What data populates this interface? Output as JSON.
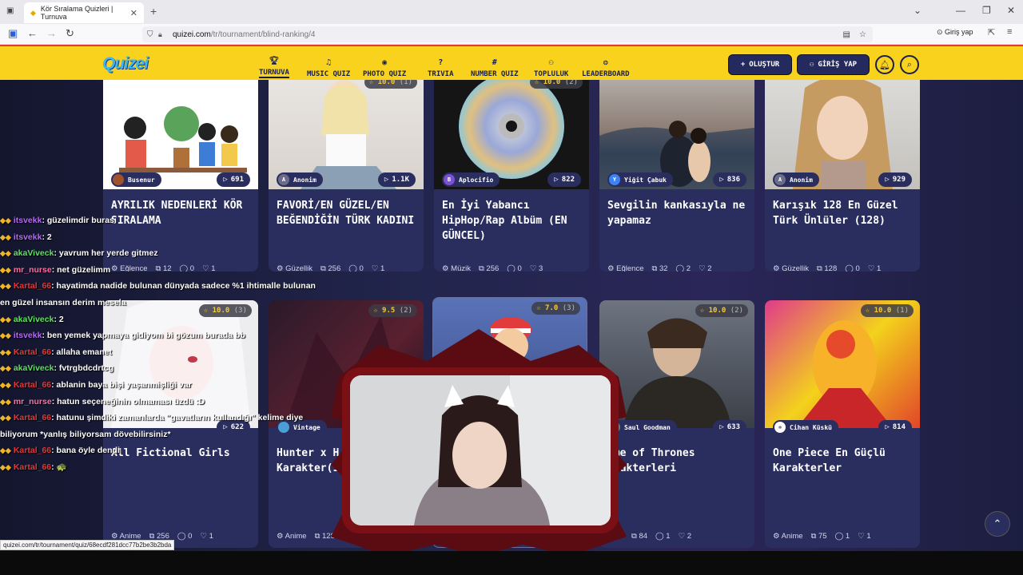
{
  "browser": {
    "tab_title": "Kör Sıralama Quizleri | Turnuva",
    "url_host": "quizei.com",
    "url_path": "/tr/tournament/blind-ranking/4",
    "login_label": "Giriş yap",
    "status_url": "quizei.com/tr/tournament/quiz/68ecdf281dcc77b2be3b2bda"
  },
  "site": {
    "logo": "Quizei",
    "nav": [
      {
        "label": "TURNUVA",
        "icon": "trophy-icon"
      },
      {
        "label": "MUSIC QUIZ",
        "icon": "music-icon"
      },
      {
        "label": "PHOTO QUIZ",
        "icon": "camera-icon"
      },
      {
        "label": "TRIVIA",
        "icon": "question-icon"
      },
      {
        "label": "NUMBER QUIZ",
        "icon": "hash-icon"
      },
      {
        "label": "TOPLULUK",
        "icon": "users-icon"
      },
      {
        "label": "LEADERBOARD",
        "icon": "medal-icon"
      }
    ],
    "create_label": "OLUŞTUR",
    "login_label": "GİRİŞ YAP"
  },
  "cards": [
    {
      "rating": "",
      "count": "",
      "author": "Busenur",
      "author_initial": "",
      "plays": "691",
      "title": "AYRILIK NEDENLERİ KÖR SIRALAMA",
      "category": "Eğlence",
      "items": "12",
      "comments": "0",
      "likes": "1"
    },
    {
      "rating": "10.0",
      "count": "(1)",
      "author": "Anonim",
      "author_initial": "A",
      "plays": "1.1K",
      "title": "FAVORİ/EN GÜZEL/EN BEĞENDİĞİN TÜRK KADINI",
      "category": "Güzellik",
      "items": "256",
      "comments": "0",
      "likes": "1"
    },
    {
      "rating": "10.0",
      "count": "(2)",
      "author": "Aplocifio",
      "author_initial": "B",
      "plays": "822",
      "title": "En İyi Yabancı HipHop/Rap Albüm (EN GÜNCEL)",
      "category": "Müzik",
      "items": "256",
      "comments": "0",
      "likes": "3"
    },
    {
      "rating": "",
      "count": "",
      "author": "Yiğit Çabuk",
      "author_initial": "Y",
      "plays": "836",
      "title": "Sevgilin kankasıyla ne yapamaz",
      "category": "Eğlence",
      "items": "32",
      "comments": "2",
      "likes": "2"
    },
    {
      "rating": "",
      "count": "",
      "author": "Anonim",
      "author_initial": "A",
      "plays": "929",
      "title": "Karışık 128 En Güzel Türk Ünlüler (128)",
      "category": "Güzellik",
      "items": "128",
      "comments": "0",
      "likes": "1"
    },
    {
      "rating": "10.0",
      "count": "(3)",
      "author": "",
      "author_initial": "",
      "plays": "622",
      "title": "All Fictional Girls",
      "category": "Anime",
      "items": "256",
      "comments": "0",
      "likes": "1"
    },
    {
      "rating": "9.5",
      "count": "(2)",
      "author": "Vintage",
      "author_initial": "",
      "plays": "",
      "title": "Hunter x H Anime/Mang Karakter(1",
      "category": "Anime",
      "items": "128",
      "comments": "0",
      "likes": ""
    },
    {
      "rating": "7.0",
      "count": "(3)",
      "author": "",
      "author_initial": "",
      "plays": "",
      "title": "",
      "category": "",
      "items": "",
      "comments": "0",
      "likes": ""
    },
    {
      "rating": "10.0",
      "count": "(2)",
      "author": "Saul Goodman",
      "author_initial": "",
      "plays": "633",
      "title": "ame of Thrones arakterleri",
      "category": "",
      "items": "84",
      "comments": "1",
      "likes": "2"
    },
    {
      "rating": "10.0",
      "count": "(1)",
      "author": "Cihan Küskü",
      "author_initial": "",
      "plays": "814",
      "title": "One Piece En Güçlü Karakterler",
      "category": "Anime",
      "items": "75",
      "comments": "1",
      "likes": "1"
    }
  ],
  "chat": [
    {
      "user": "itsvekk",
      "color": "purple",
      "message": ": güzelimdir burası"
    },
    {
      "user": "itsvekk",
      "color": "purple",
      "message": ": 2"
    },
    {
      "user": "akaViveck",
      "color": "green",
      "message": ": yavrum her yerde gitmez"
    },
    {
      "user": "mr_nurse",
      "color": "pink",
      "message": ": net güzelimm"
    },
    {
      "user": "Kartal_66",
      "color": "red",
      "message": ": hayatimda nadide bulunan dünyada sadece %1 ihtimalle bulunan"
    },
    {
      "user": "",
      "color": "",
      "message": "en güzel insansın derim mesela"
    },
    {
      "user": "akaViveck",
      "color": "green",
      "message": ": 2"
    },
    {
      "user": "itsvekk",
      "color": "purple",
      "message": ": ben yemek yapmaya gidiyom bi gözum burada bb"
    },
    {
      "user": "Kartal_66",
      "color": "red",
      "message": ": allaha emanet"
    },
    {
      "user": "akaViveck",
      "color": "green",
      "message": ": fvtrgbdcdrtcg"
    },
    {
      "user": "Kartal_66",
      "color": "red",
      "message": ": ablanin baya bişi yaşanmişliği var"
    },
    {
      "user": "mr_nurse",
      "color": "pink",
      "message": ": hatun seçeneğinin olmaması üzdü :D"
    },
    {
      "user": "Kartal_66",
      "color": "red",
      "message": ": hatunu şimdiki zamanlarda \"gavatların kullandığı\" kelime diye"
    },
    {
      "user": "",
      "color": "",
      "message": "biliyorum *yanlış biliyorsam dövebilirsiniz*"
    },
    {
      "user": "Kartal_66",
      "color": "red",
      "message": ": bana öyle dendi"
    },
    {
      "user": "Kartal_66",
      "color": "red",
      "message": ": 🐢"
    }
  ],
  "colors": {
    "header": "#f8d21c",
    "card": "#2a2e5e",
    "rating": "#f6c93c",
    "accent_red": "#e53935"
  }
}
